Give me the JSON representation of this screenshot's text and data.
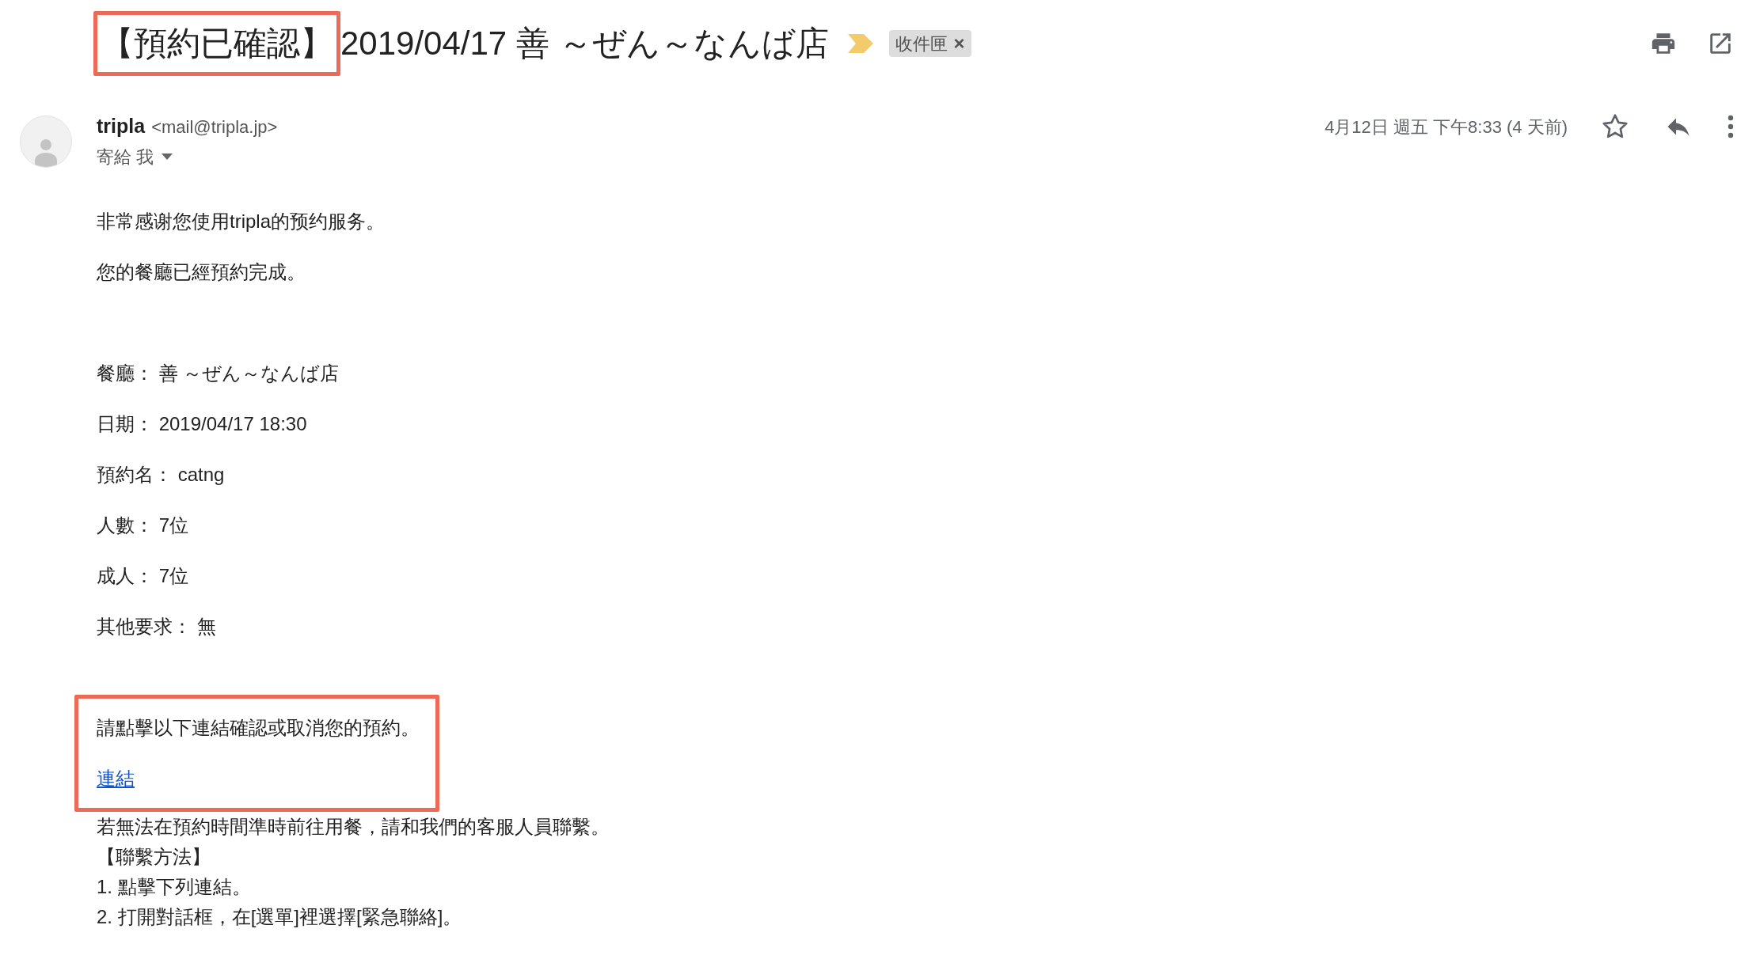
{
  "subject": {
    "parts": [
      {
        "text": "【預約已確認】",
        "highlighted": true
      },
      {
        "text": "2019/04/17 善 ～ぜん～なんば店",
        "highlighted": false
      }
    ]
  },
  "label": {
    "text": "收件匣",
    "remove": "×"
  },
  "sender": {
    "name": "tripla",
    "email": "<mail@tripla.jp>",
    "recipient": "寄給 我",
    "date": "4月12日 週五 下午8:33 (4 天前)",
    "starred": false
  },
  "body": {
    "blocks": [
      {
        "kind": "paragraphs",
        "highlighted": false,
        "items": [
          {
            "kind": "text",
            "text": "非常感谢您使用tripla的预约服务。"
          },
          {
            "kind": "text",
            "text": "您的餐廳已經預約完成。"
          }
        ]
      },
      {
        "kind": "paragraphs",
        "highlighted": false,
        "items": [
          {
            "kind": "text",
            "text": "餐廳： 善 ～ぜん～なんば店"
          },
          {
            "kind": "text",
            "text": "日期： 2019/04/17 18:30"
          },
          {
            "kind": "text",
            "text": "預約名： catng"
          },
          {
            "kind": "text",
            "text": "人數： 7位"
          },
          {
            "kind": "text",
            "text": "成人： 7位"
          },
          {
            "kind": "text",
            "text": "其他要求： 無"
          }
        ]
      },
      {
        "kind": "paragraphs",
        "highlighted": true,
        "items": [
          {
            "kind": "text",
            "text": "請點擊以下連結確認或取消您的預約。"
          },
          {
            "kind": "link",
            "text": "連結"
          }
        ]
      },
      {
        "kind": "lines",
        "highlighted": false,
        "items": [
          {
            "kind": "text",
            "text": "若無法在預約時間準時前往用餐，請和我們的客服人員聯繫。"
          },
          {
            "kind": "text",
            "text": "【聯繫方法】"
          },
          {
            "kind": "text",
            "text": "1. 點擊下列連結。"
          },
          {
            "kind": "text",
            "text": "2. 打開對話框，在[選單]裡選擇[緊急聯絡]。"
          }
        ]
      }
    ]
  }
}
